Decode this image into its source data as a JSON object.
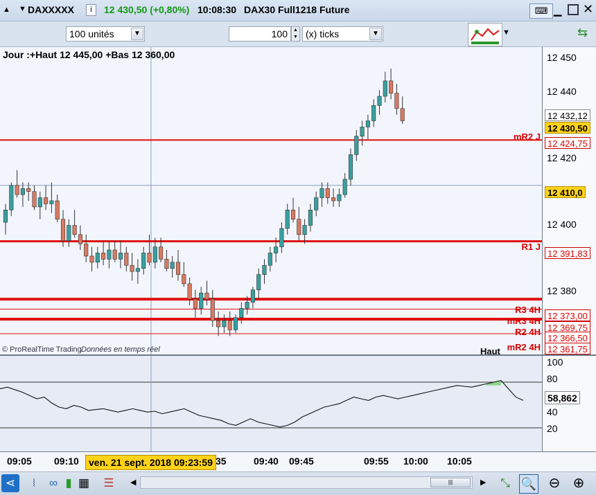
{
  "header": {
    "instrument": "DAXXXXX",
    "price": "12 430,50 (+0,80%)",
    "time": "10:08:30",
    "description": "DAX30 Full1218 Future"
  },
  "toolbar": {
    "quantity": "100 unités",
    "ticks_value": "100",
    "ticks_unit": "(x) ticks"
  },
  "chart_info": {
    "day_range": "Jour :+Haut 12 445,00 +Bas 12 360,00",
    "copyright": "© ProRealTime Trading",
    "realtime": "Données en temps réel",
    "partial_label": "Haut"
  },
  "price_axis": {
    "ticks": [
      "12 450",
      "12 440",
      "12 420",
      "12 400",
      "12 380"
    ],
    "tags": {
      "current": "12 432,12",
      "last": "12 430,50",
      "mr2j": "12 424,75",
      "cursor": "12 410,0",
      "r1j": "12 391,83",
      "r34h": "12 373,00",
      "mr34h": "12 369,75",
      "r24h": "12 366,50",
      "mr24h": "12 361,75"
    }
  },
  "levels": {
    "mr2j": "mR2 J",
    "r1j": "R1 J",
    "r34h": "R3 4H",
    "mr34h": "mR3 4H",
    "r24h": "R2 4H",
    "mr24h": "mR2 4H"
  },
  "oscillator": {
    "ticks": [
      "100",
      "80",
      "60",
      "40",
      "20"
    ],
    "value": "58,862"
  },
  "time_axis": {
    "labels": [
      "09:05",
      "09:10",
      "35",
      "09:40",
      "09:45",
      "09:55",
      "10:00",
      "10:05"
    ],
    "cursor_label": "ven. 21 sept. 2018 09:23:59"
  },
  "colors": {
    "up": "#3aa0a0",
    "down": "#d97a62",
    "level": "#e01010",
    "last_tag": "#ffd21a",
    "osc_fill": "#8ed58e"
  },
  "chart_data": {
    "type": "candlestick",
    "ylim": [
      12355,
      12455
    ],
    "candles": [
      [
        12398,
        12404,
        12394,
        12402
      ],
      [
        12402,
        12411,
        12400,
        12410
      ],
      [
        12410,
        12415,
        12406,
        12407
      ],
      [
        12407,
        12411,
        12403,
        12409
      ],
      [
        12409,
        12411,
        12405,
        12408
      ],
      [
        12408,
        12410,
        12402,
        12403
      ],
      [
        12403,
        12408,
        12399,
        12406
      ],
      [
        12406,
        12410,
        12402,
        12404
      ],
      [
        12404,
        12411,
        12401,
        12405
      ],
      [
        12405,
        12407,
        12398,
        12399
      ],
      [
        12399,
        12402,
        12390,
        12392
      ],
      [
        12392,
        12399,
        12390,
        12397
      ],
      [
        12397,
        12402,
        12393,
        12394
      ],
      [
        12394,
        12397,
        12389,
        12391
      ],
      [
        12391,
        12394,
        12385,
        12387
      ],
      [
        12387,
        12390,
        12382,
        12385
      ],
      [
        12385,
        12390,
        12383,
        12388
      ],
      [
        12388,
        12392,
        12384,
        12386
      ],
      [
        12386,
        12392,
        12383,
        12389
      ],
      [
        12389,
        12392,
        12385,
        12386
      ],
      [
        12386,
        12392,
        12383,
        12388
      ],
      [
        12388,
        12390,
        12382,
        12384
      ],
      [
        12384,
        12388,
        12379,
        12382
      ],
      [
        12382,
        12386,
        12378,
        12383
      ],
      [
        12383,
        12390,
        12381,
        12388
      ],
      [
        12388,
        12394,
        12384,
        12385
      ],
      [
        12385,
        12393,
        12383,
        12390
      ],
      [
        12390,
        12393,
        12385,
        12386
      ],
      [
        12386,
        12389,
        12382,
        12383
      ],
      [
        12383,
        12387,
        12380,
        12385
      ],
      [
        12385,
        12389,
        12379,
        12381
      ],
      [
        12381,
        12385,
        12377,
        12378
      ],
      [
        12378,
        12380,
        12371,
        12373
      ],
      [
        12373,
        12376,
        12367,
        12370
      ],
      [
        12370,
        12377,
        12368,
        12375
      ],
      [
        12375,
        12379,
        12371,
        12373
      ],
      [
        12373,
        12376,
        12364,
        12366
      ],
      [
        12366,
        12369,
        12361,
        12364
      ],
      [
        12364,
        12368,
        12362,
        12366
      ],
      [
        12366,
        12369,
        12361,
        12363
      ],
      [
        12363,
        12368,
        12362,
        12367
      ],
      [
        12367,
        12372,
        12365,
        12370
      ],
      [
        12370,
        12374,
        12368,
        12372
      ],
      [
        12372,
        12377,
        12370,
        12376
      ],
      [
        12376,
        12383,
        12373,
        12381
      ],
      [
        12381,
        12386,
        12378,
        12384
      ],
      [
        12384,
        12390,
        12382,
        12388
      ],
      [
        12388,
        12393,
        12385,
        12390
      ],
      [
        12390,
        12398,
        12388,
        12396
      ],
      [
        12396,
        12404,
        12394,
        12402
      ],
      [
        12402,
        12406,
        12398,
        12399
      ],
      [
        12399,
        12403,
        12392,
        12394
      ],
      [
        12394,
        12399,
        12391,
        12397
      ],
      [
        12397,
        12404,
        12395,
        12402
      ],
      [
        12402,
        12408,
        12400,
        12406
      ],
      [
        12406,
        12411,
        12403,
        12409
      ],
      [
        12409,
        12411,
        12404,
        12406
      ],
      [
        12406,
        12409,
        12403,
        12405
      ],
      [
        12405,
        12409,
        12403,
        12407
      ],
      [
        12407,
        12414,
        12406,
        12412
      ],
      [
        12412,
        12422,
        12410,
        12420
      ],
      [
        12420,
        12428,
        12418,
        12426
      ],
      [
        12426,
        12431,
        12423,
        12429
      ],
      [
        12429,
        12433,
        12425,
        12431
      ],
      [
        12431,
        12438,
        12429,
        12436
      ],
      [
        12436,
        12441,
        12433,
        12439
      ],
      [
        12439,
        12447,
        12437,
        12444
      ],
      [
        12444,
        12448,
        12438,
        12440
      ],
      [
        12440,
        12443,
        12433,
        12435
      ],
      [
        12435,
        12439,
        12430,
        12431
      ]
    ],
    "oscillator": [
      72,
      74,
      71,
      68,
      64,
      60,
      62,
      55,
      50,
      48,
      52,
      50,
      46,
      47,
      48,
      46,
      44,
      46,
      48,
      46,
      44,
      45,
      42,
      44,
      46,
      48,
      44,
      40,
      38,
      36,
      34,
      30,
      28,
      32,
      36,
      32,
      30,
      28,
      26,
      28,
      32,
      38,
      42,
      46,
      50,
      52,
      54,
      58,
      62,
      60,
      58,
      62,
      64,
      62,
      60,
      62,
      64,
      66,
      68,
      70,
      72,
      74,
      76,
      75,
      74,
      76,
      78,
      80,
      82,
      72,
      62,
      58
    ],
    "osc_lines": [
      80,
      25
    ]
  }
}
